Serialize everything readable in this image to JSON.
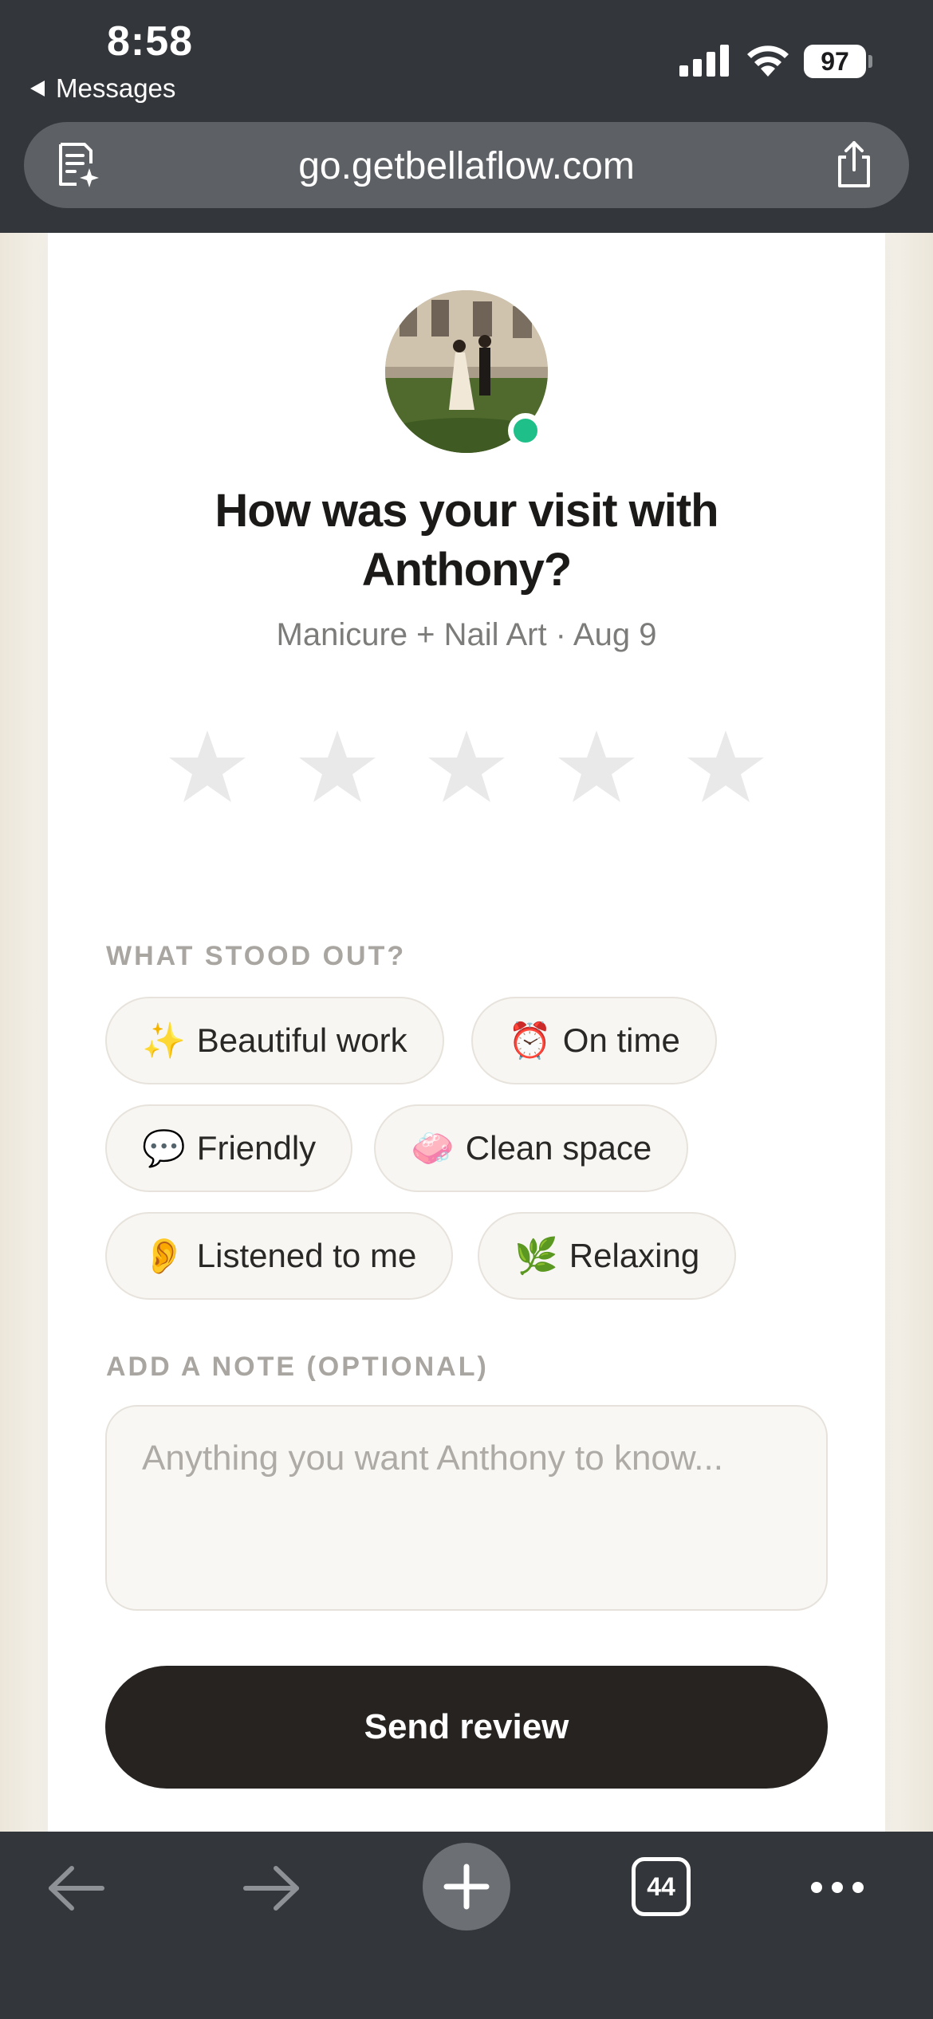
{
  "status_bar": {
    "time": "8:58",
    "back_app": "Messages",
    "battery": "97"
  },
  "browser": {
    "url": "go.getbellaflow.com",
    "tab_count": "44"
  },
  "review": {
    "title_line1": "How was your visit with",
    "title_line2": "Anthony?",
    "subtitle": "Manicure + Nail Art · Aug 9",
    "rating": 0,
    "star_count": 5,
    "stood_out_label": "WHAT STOOD OUT?",
    "chips": [
      {
        "emoji": "✨",
        "label": "Beautiful work"
      },
      {
        "emoji": "⏰",
        "label": "On time"
      },
      {
        "emoji": "💬",
        "label": "Friendly"
      },
      {
        "emoji": "🧼",
        "label": "Clean space"
      },
      {
        "emoji": "👂",
        "label": "Listened to me"
      },
      {
        "emoji": "🌿",
        "label": "Relaxing"
      }
    ],
    "note_label": "ADD A NOTE (OPTIONAL)",
    "note_placeholder": "Anything you want Anthony to know...",
    "note_value": "",
    "send_label": "Send review"
  },
  "colors": {
    "accent_online": "#1fbf8a",
    "button_dark": "#272321",
    "star_empty": "#e9e9e9",
    "chrome": "#33363a"
  }
}
